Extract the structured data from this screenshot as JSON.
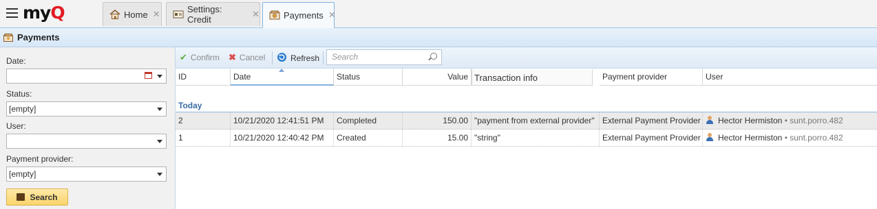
{
  "app": {
    "brand_prefix": "my",
    "brand_suffix": "Q"
  },
  "tabs": [
    {
      "label": "Home",
      "icon": "home-icon",
      "active": false
    },
    {
      "label": "Settings: Credit",
      "icon": "settings-icon",
      "active": false
    },
    {
      "label": "Payments",
      "icon": "payments-icon",
      "active": true
    }
  ],
  "tab_close_glyph": "✕",
  "page": {
    "title": "Payments"
  },
  "filter": {
    "date_label": "Date:",
    "date_value": "",
    "status_label": "Status:",
    "status_value": "[empty]",
    "user_label": "User:",
    "user_value": "",
    "provider_label": "Payment provider:",
    "provider_value": "[empty]",
    "search_label": "Search"
  },
  "toolbar": {
    "confirm": "Confirm",
    "cancel": "Cancel",
    "refresh": "Refresh",
    "search_placeholder": "Search"
  },
  "grid": {
    "columns": [
      "ID",
      "Date",
      "Status",
      "Value",
      "Transaction info",
      "Payment provider",
      "User"
    ],
    "sorted_column": "Date",
    "group_label": "Today",
    "rows": [
      {
        "id": "2",
        "date": "10/21/2020 12:41:51 PM",
        "status": "Completed",
        "value": "150.00",
        "info": "\"payment from external provider\"",
        "provider": "External Payment Provider",
        "user": "Hector Hermiston",
        "user_login": "• sunt.porro.482",
        "selected": true
      },
      {
        "id": "1",
        "date": "10/21/2020 12:40:42 PM",
        "status": "Created",
        "value": "15.00",
        "info": "\"string\"",
        "provider": "External Payment Provider",
        "user": "Hector Hermiston",
        "user_login": "• sunt.porro.482",
        "selected": false
      }
    ]
  },
  "colors": {
    "accent": "#3a6ea5",
    "brand_red": "#e21b22",
    "search_button": "#fbd46b"
  }
}
